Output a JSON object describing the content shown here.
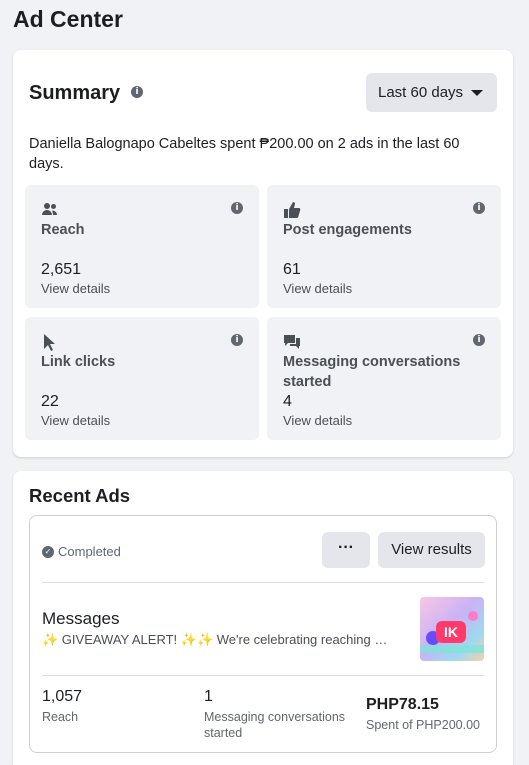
{
  "page_title": "Ad Center",
  "summary": {
    "title": "Summary",
    "info_icon": "i",
    "date_range": "Last 60 days",
    "description": "Daniella Balognapo Cabeltes spent ₱200.00 on 2 ads in the last 60 days.",
    "tiles": [
      {
        "icon": "people-icon",
        "label": "Reach",
        "value": "2,651",
        "link": "View details"
      },
      {
        "icon": "thumbs-up-icon",
        "label": "Post engagements",
        "value": "61",
        "link": "View details"
      },
      {
        "icon": "cursor-icon",
        "label": "Link clicks",
        "value": "22",
        "link": "View details"
      },
      {
        "icon": "chat-icon",
        "label": "Messaging conversations started",
        "value": "4",
        "link": "View details"
      }
    ]
  },
  "recent_ads": {
    "title": "Recent Ads",
    "ad": {
      "status": "Completed",
      "more_label": "···",
      "view_results_label": "View results",
      "name": "Messages",
      "text_emoji_1": "✨",
      "text_main": " GIVEAWAY ALERT! ",
      "text_emoji_2": "✨✨",
      "text_tail": " We're celebrating reaching ou...",
      "thumbnail_label": "IK",
      "stats": [
        {
          "value": "1,057",
          "label": "Reach"
        },
        {
          "value": "1",
          "label": "Messaging conversations started"
        },
        {
          "value": "PHP78.15",
          "label": "Spent of PHP200.00"
        }
      ]
    }
  }
}
